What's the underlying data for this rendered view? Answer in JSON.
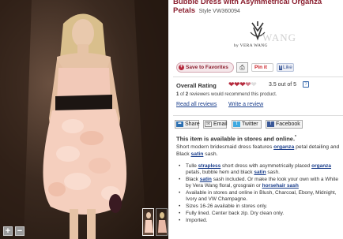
{
  "product": {
    "title": "Bubble Dress with Asymmetrical Organza Petals",
    "style_label": "Style VW360094"
  },
  "brand": {
    "name": "VERA WANG",
    "logo_text": "by VERA WANG",
    "watermark": "WANG"
  },
  "actions": {
    "favorites": "Save to Favorites",
    "pinit": "Pin it",
    "like": "Like"
  },
  "rating": {
    "label": "Overall Rating",
    "score": "3.5 out of 5",
    "score_value": 3.5,
    "max": 5,
    "help_icon": "?",
    "recommend_count": "1",
    "recommend_of": "2",
    "recommend_tail": "reviewers would recommend this product.",
    "read_all": "Read all reviews",
    "write": "Write a review"
  },
  "share": {
    "share": "Share",
    "email": "Email",
    "twitter": "Twitter",
    "facebook": "Facebook"
  },
  "availability": "This item is available in stores and online.",
  "availability_mark": "*",
  "description": {
    "p1": "Short modern bridesmaid dress features",
    "link1": "organza",
    "p2": "petal detailing and Black",
    "link2": "satin",
    "p3": "sash."
  },
  "features": {
    "f1a": "Tulle",
    "f1_link1": "strapless",
    "f1b": "short dress with asymmetrically placed",
    "f1_link2": "organza",
    "f1c": "petals, bubble hem and black",
    "f1_link3": "satin",
    "f1d": "sash.",
    "f2a": "Black",
    "f2_link1": "satin",
    "f2b": "sash included. Or make the look your own with a White by Vera Wang floral, grosgrain or",
    "f2_link2": "horsehair sash",
    "f3": "Available in stores and online in Blush, Charcoal, Ebony, Midnight, Ivory and VW Champagne.",
    "f4": "Sizes 16-26 available in stores only.",
    "f5": "Fully lined. Center back zip. Dry clean only.",
    "f6": "Imported."
  },
  "viewer": {
    "zoom_in": "+",
    "zoom_out": "−"
  },
  "colors": {
    "brand_red": "#8b1f2f",
    "link_blue": "#1a3e8c",
    "heart": "#b52a3d"
  }
}
